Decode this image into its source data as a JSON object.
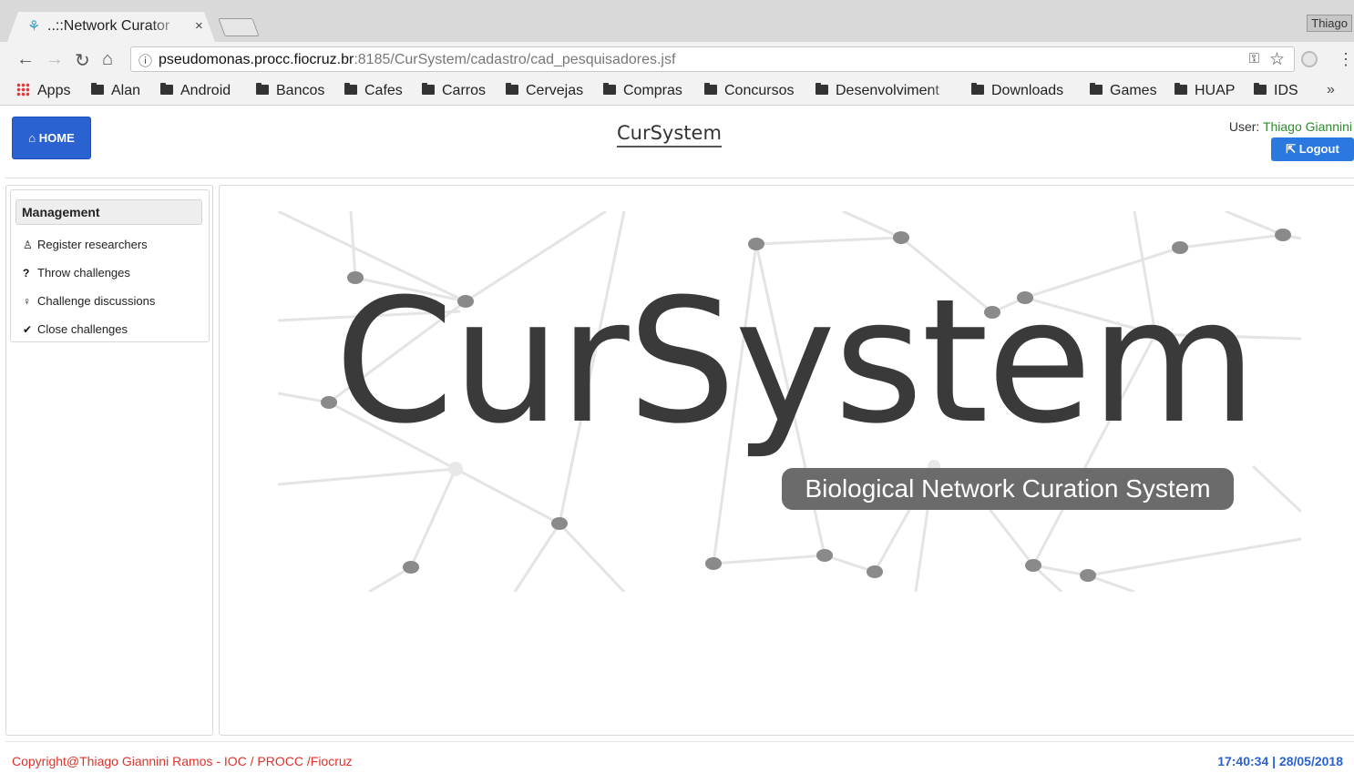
{
  "browser": {
    "tab_title": "..::Network Curator",
    "tab_close": "×",
    "profile": "Thiago",
    "url_host": "pseudomonas.procc.fiocruz.br",
    "url_rest": ":8185/CurSystem/cadastro/cad_pesquisadores.jsf",
    "bookmarks": [
      "Apps",
      "Alan",
      "Android",
      "Bancos",
      "Cafes",
      "Carros",
      "Cervejas",
      "Compras",
      "Concursos",
      "Desenvolviment",
      "Downloads",
      "Games",
      "HUAP",
      "IDS"
    ],
    "bookmarks_more": "»"
  },
  "header": {
    "home_label": "HOME",
    "brand": "CurSystem",
    "user_prefix": "User: ",
    "user_name": "Thiago Giannini",
    "logout_label": "Logout"
  },
  "sidebar": {
    "heading": "Management",
    "items": [
      {
        "label": "Register researchers",
        "icon": "user-icon"
      },
      {
        "label": "Throw challenges",
        "icon": "question-icon"
      },
      {
        "label": "Challenge discussions",
        "icon": "lightbulb-icon"
      },
      {
        "label": "Close challenges",
        "icon": "check-icon"
      }
    ]
  },
  "banner": {
    "title": "CurSystem",
    "subtitle": "Biological Network Curation System"
  },
  "footer": {
    "copyright": "Copyright@Thiago Giannini Ramos - IOC / PROCC /Fiocruz",
    "clock": "17:40:34 | 28/05/2018"
  },
  "colors": {
    "home_button": "#2a62d2",
    "logout_button": "#2a78e0",
    "user_name": "#2e8b2e",
    "copyright": "#e0302a",
    "clock": "#2a62d2"
  }
}
